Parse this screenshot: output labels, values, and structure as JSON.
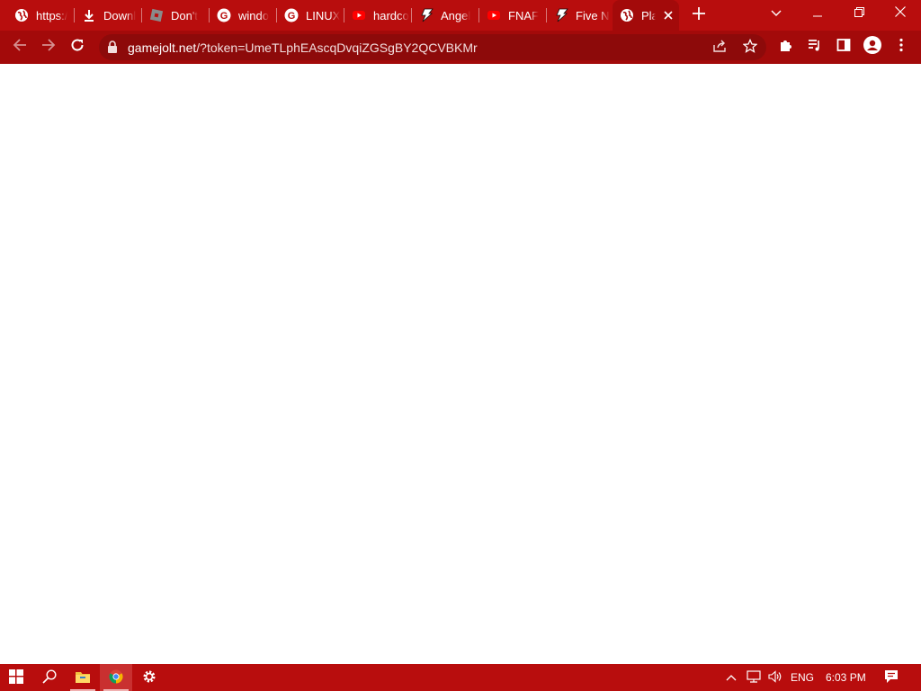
{
  "browser": {
    "tabs": [
      {
        "label": "https:/",
        "icon": "globe-icon",
        "active": false
      },
      {
        "label": "Downl",
        "icon": "download-icon",
        "active": false
      },
      {
        "label": "Don't",
        "icon": "roblox-icon",
        "active": false
      },
      {
        "label": "windo",
        "icon": "google-icon",
        "active": false
      },
      {
        "label": "LINUX",
        "icon": "google-icon",
        "active": false
      },
      {
        "label": "hardco",
        "icon": "youtube-icon",
        "active": false
      },
      {
        "label": "Angel",
        "icon": "gamejolt-icon",
        "active": false
      },
      {
        "label": "FNAF",
        "icon": "youtube-icon",
        "active": false
      },
      {
        "label": "Five N",
        "icon": "gamejolt-icon",
        "active": false
      },
      {
        "label": "Pla",
        "icon": "globe-icon",
        "active": true
      }
    ],
    "new_tab_icon": "plus-icon",
    "window_controls": [
      "tab-search-icon",
      "minimize-icon",
      "restore-icon",
      "close-icon"
    ],
    "address": {
      "host": "gamejolt.net",
      "path": "/?token=UmeTLphEAscqDvqiZGSgBY2QCVBKMr"
    },
    "colors": {
      "frame": "#b80d0d",
      "toolbar": "#a30a0a",
      "omnibox": "#8d0a0a"
    }
  },
  "taskbar": {
    "language": "ENG",
    "clock": "6:03 PM",
    "apps": [
      "start-icon",
      "search-icon",
      "file-explorer-icon",
      "chrome-icon",
      "settings-icon"
    ]
  }
}
